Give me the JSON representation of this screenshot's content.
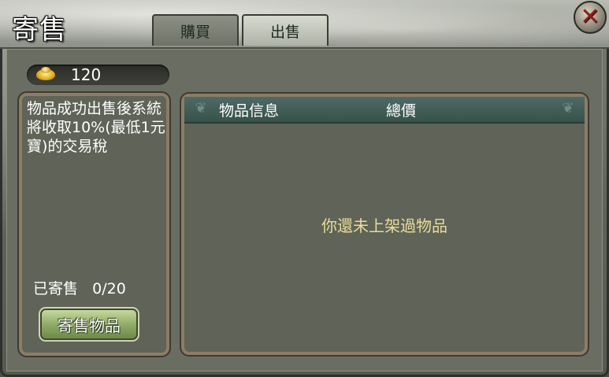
{
  "window": {
    "title": "寄售",
    "close_label": "✕"
  },
  "tabs": [
    {
      "label": "購買",
      "active": false
    },
    {
      "label": "出售",
      "active": true
    }
  ],
  "gold": {
    "amount": "120"
  },
  "left_panel": {
    "notice": "物品成功出售後系統將收取10%(最低1元寶)的交易稅",
    "count_label": "已寄售",
    "count_value": "0/20",
    "consign_button": "寄售物品"
  },
  "table": {
    "columns": [
      "物品信息",
      "總價"
    ],
    "empty_message": "你還未上架過物品"
  },
  "colors": {
    "accent_gold": "#e0a81a",
    "close_red": "#8e1f18",
    "header_teal": "#4f6a64",
    "button_green": "#8ca863"
  }
}
